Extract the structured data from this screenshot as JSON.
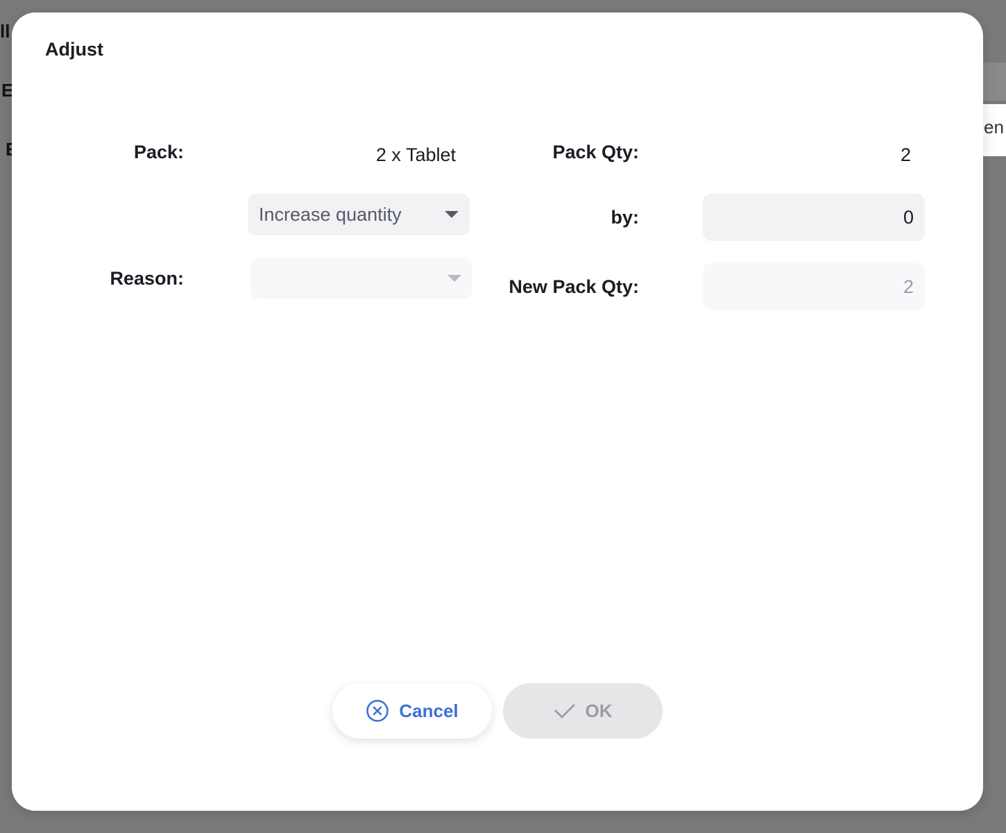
{
  "background": {
    "fragment_1": "ll",
    "fragment_2": "E",
    "fragment_3": "E",
    "fragment_4": "en"
  },
  "dialog": {
    "title": "Adjust",
    "pack_label": "Pack:",
    "pack_value": "2 x Tablet",
    "pack_qty_label": "Pack Qty:",
    "pack_qty_value": "2",
    "adjustment_type": "Increase quantity",
    "by_label": "by:",
    "by_value": "0",
    "reason_label": "Reason:",
    "reason_value": "",
    "new_pack_qty_label": "New Pack Qty:",
    "new_pack_qty_value": "2",
    "cancel_label": "Cancel",
    "ok_label": "OK"
  },
  "colors": {
    "accent": "#3f6fd8",
    "overlay": "#7a7a7a",
    "disabled_button": "#e6e6e8"
  },
  "icons": {
    "cancel": "x-circle-icon",
    "ok": "check-icon",
    "dropdown": "caret-down-icon"
  }
}
